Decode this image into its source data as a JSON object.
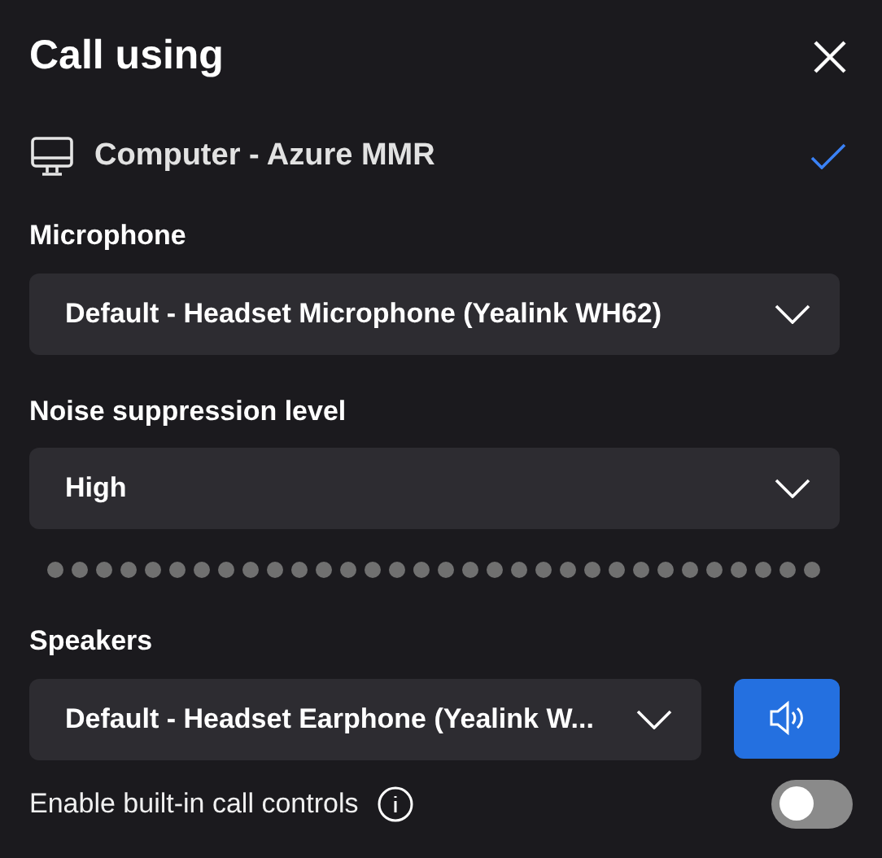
{
  "title": "Call using",
  "device": {
    "label": "Computer - Azure MMR",
    "selected": true
  },
  "microphone": {
    "label": "Microphone",
    "value": "Default - Headset Microphone (Yealink WH62)"
  },
  "noise_suppression": {
    "label": "Noise suppression level",
    "value": "High"
  },
  "speakers": {
    "label": "Speakers",
    "value": "Default - Headset Earphone (Yealink W..."
  },
  "call_controls": {
    "label": "Enable built-in call controls",
    "on": false
  }
}
